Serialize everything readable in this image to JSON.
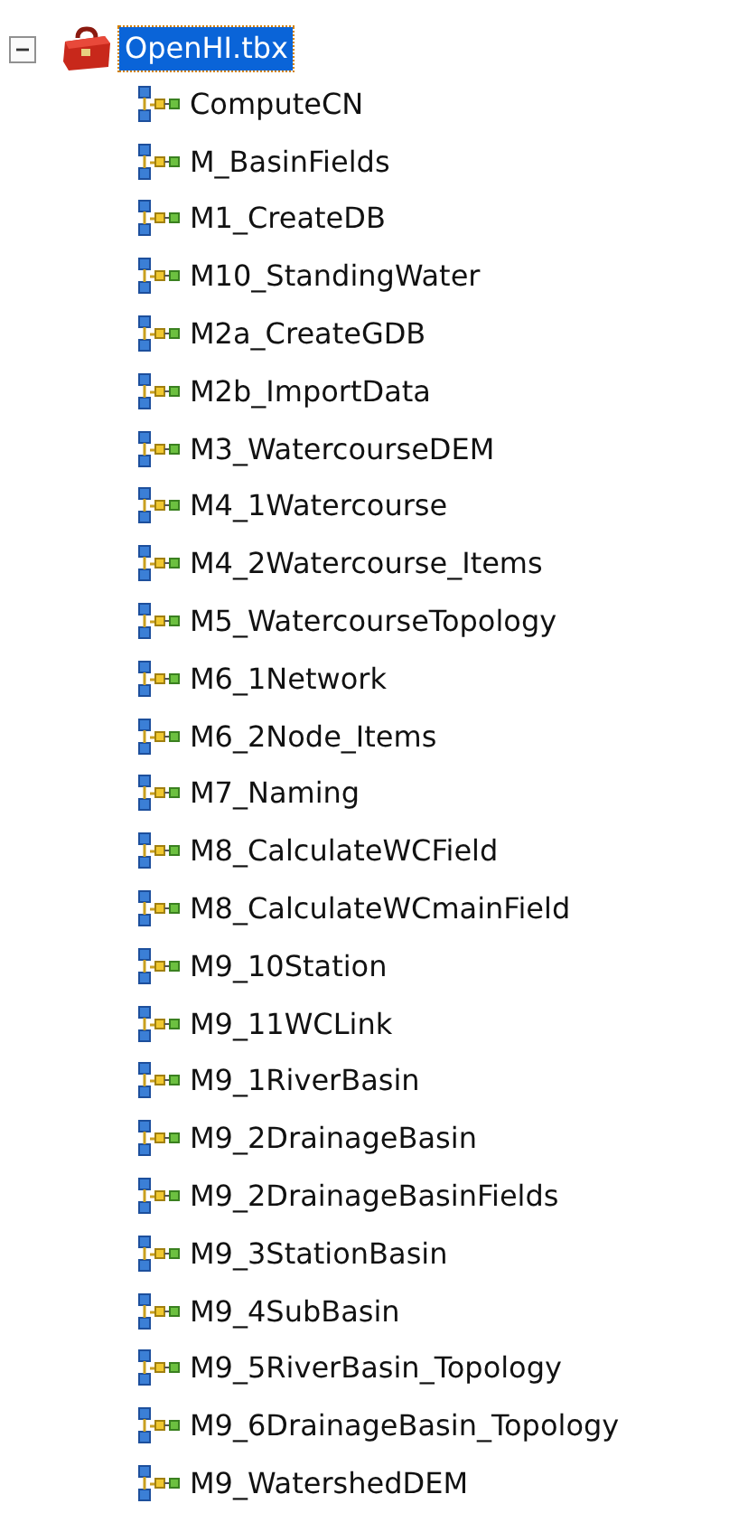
{
  "tree": {
    "label": "OpenHI.tbx",
    "expanded": true,
    "selected": true,
    "children": [
      {
        "label": "ComputeCN"
      },
      {
        "label": "M_BasinFields"
      },
      {
        "label": "M1_CreateDB"
      },
      {
        "label": "M10_StandingWater"
      },
      {
        "label": "M2a_CreateGDB"
      },
      {
        "label": "M2b_ImportData"
      },
      {
        "label": "M3_WatercourseDEM"
      },
      {
        "label": "M4_1Watercourse"
      },
      {
        "label": "M4_2Watercourse_Items"
      },
      {
        "label": "M5_WatercourseTopology"
      },
      {
        "label": "M6_1Network"
      },
      {
        "label": "M6_2Node_Items"
      },
      {
        "label": "M7_Naming"
      },
      {
        "label": "M8_CalculateWCField"
      },
      {
        "label": "M8_CalculateWCmainField"
      },
      {
        "label": "M9_10Station"
      },
      {
        "label": "M9_11WCLink"
      },
      {
        "label": "M9_1RiverBasin"
      },
      {
        "label": "M9_2DrainageBasin"
      },
      {
        "label": "M9_2DrainageBasinFields"
      },
      {
        "label": "M9_3StationBasin"
      },
      {
        "label": "M9_4SubBasin"
      },
      {
        "label": "M9_5RiverBasin_Topology"
      },
      {
        "label": "M9_6DrainageBasin_Topology"
      },
      {
        "label": "M9_WatershedDEM"
      }
    ]
  }
}
